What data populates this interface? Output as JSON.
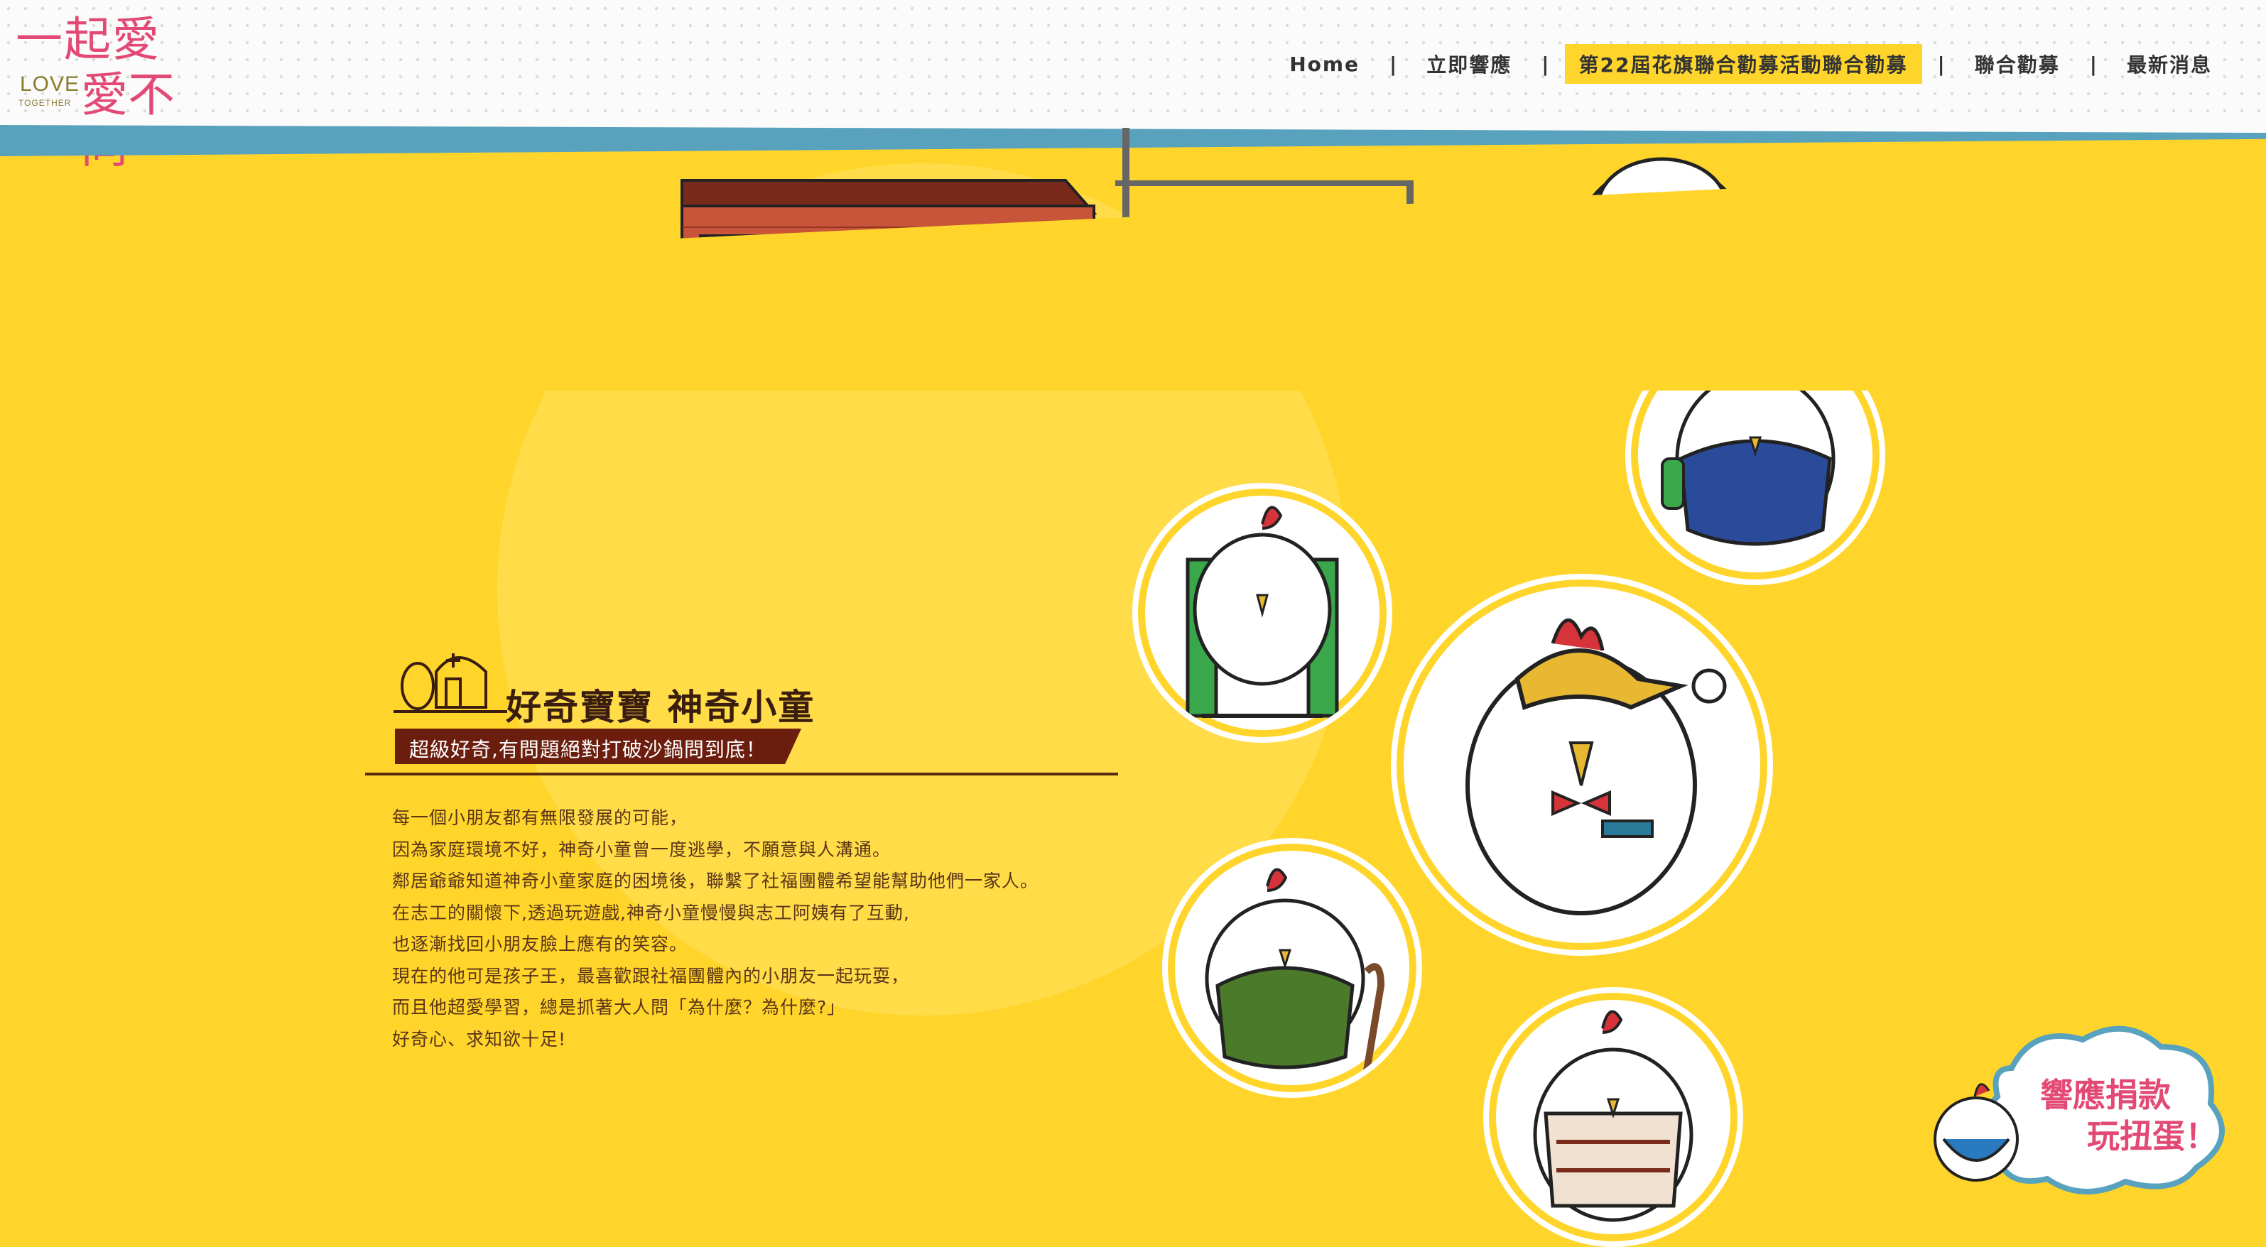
{
  "logo": {
    "line1": "一起愛",
    "love": "LOVE",
    "together": "TOGETHER",
    "line2": "愛不同"
  },
  "nav": [
    {
      "label": "Home",
      "active": false
    },
    {
      "label": "立即響應",
      "active": false
    },
    {
      "label": "第22屆花旗聯合勸募活動聯合勸募",
      "active": true
    },
    {
      "label": "聯合勸募",
      "active": false
    },
    {
      "label": "最新消息",
      "active": false
    }
  ],
  "nav_separator": "|",
  "section": {
    "title": "好奇寶寶 神奇小童",
    "tagline": "超級好奇,有問題絕對打破沙鍋問到底！",
    "story": [
      "每一個小朋友都有無限發展的可能，",
      "因為家庭環境不好，神奇小童曾一度逃學，不願意與人溝通。",
      "鄰居爺爺知道神奇小童家庭的困境後，聯繫了社福團體希望能幫助他們一家人。",
      "在志工的關懷下,透過玩遊戲,神奇小童慢慢與志工阿姨有了互動,",
      "也逐漸找回小朋友臉上應有的笑容。",
      "現在的他可是孩子王，最喜歡跟社福團體內的小朋友一起玩耍，",
      "而且他超愛學習，總是抓著大人問「為什麼？為什麼?」",
      "好奇心、求知欲十足!"
    ]
  },
  "cta": {
    "line1": "響應捐款",
    "line2": "玩扭蛋！"
  },
  "colors": {
    "brand_yellow": "#FFD52B",
    "brand_pink": "#E24A75",
    "stripe_blue": "#58A2BE",
    "text_brown": "#5b3418",
    "tag_bg": "#6B1E0E"
  }
}
